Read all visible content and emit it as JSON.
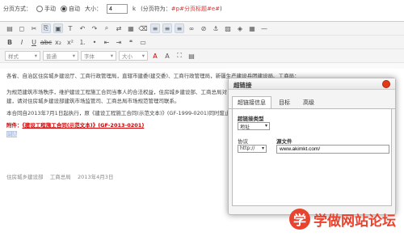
{
  "pagebar": {
    "mode_label": "分页方式：",
    "manual_label": "手动",
    "auto_label": "自动",
    "size_label": "大小：",
    "size_value": "4",
    "unit_label": "k",
    "hint_prefix": "(分页符为：",
    "hint_code": "#p#分页标题#e#",
    "hint_suffix": ")"
  },
  "toolbar": {
    "style_select": "样式",
    "normal_select": "普通",
    "font_select": "字体",
    "size_select": "大小"
  },
  "content": {
    "line1": "各省、自治区住房城乡建设厅、工商行政管理局，直辖市建委(建交委)、工商行政管理局，新疆生产建设兵团建设局、工商局：",
    "line2": "为规范建筑市场秩序，维护建设工程施工合同当事人的合法权益，住房城乡建设部、工商总局对《建设工程施工合同(示范文本)》",
    "line3": "建，请对住房城乡建设部建筑市场监管司、工商总局市场规范管理司联系。",
    "line4": "本合同自2013年7月1日起执行，原《建设工程施工合同(示范文本)》(GF-1999-0201)同时废止。",
    "attach_prefix": "附件：",
    "attach_title": "《建设工程施工合同(示范文本)》(GF-2013-0201)",
    "selected": "已选",
    "sign_org1": "住房城乡建设部",
    "sign_org2": "工商总局",
    "sign_date": "2013年4月3日"
  },
  "dialog": {
    "title": "超链接",
    "tabs": [
      "超链接信息",
      "目标",
      "高级"
    ],
    "link_type_label": "超链接类型",
    "link_type_value": "地址",
    "protocol_label": "协议",
    "protocol_value": "http://",
    "url_label": "源文件",
    "url_value": "www.akimkt.com/"
  },
  "watermark": {
    "logo_char": "学",
    "text": "学做网站论坛"
  },
  "colors": {
    "accent_red": "#e8432e",
    "link_red": "#c00"
  }
}
